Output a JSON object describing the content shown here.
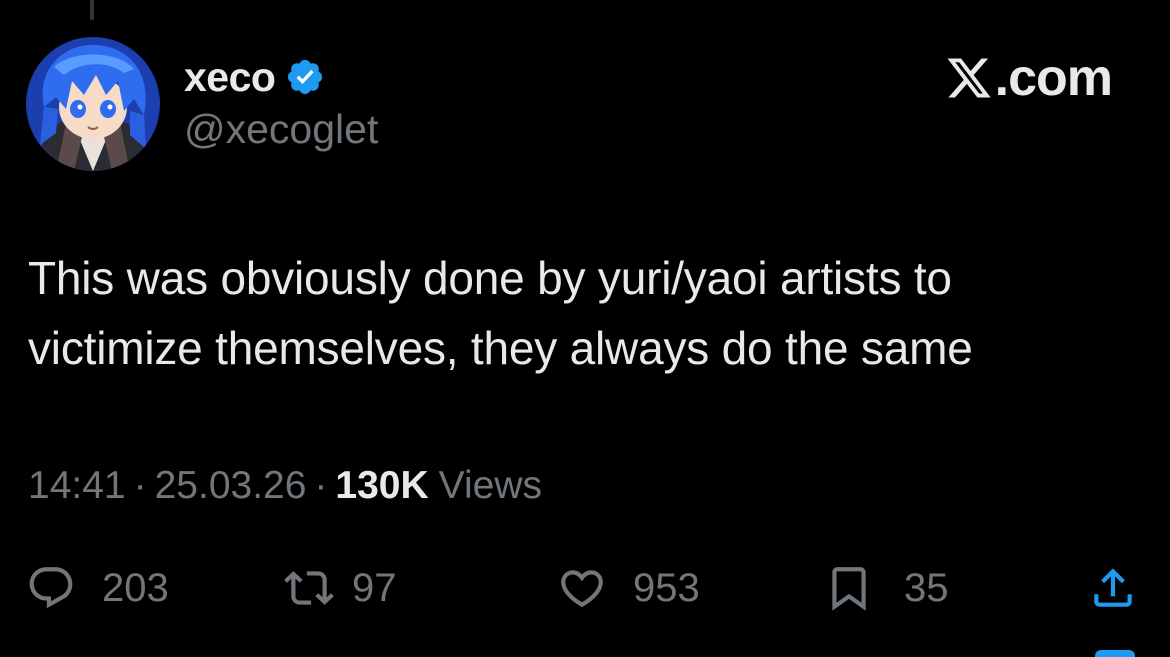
{
  "author": {
    "display_name": "xeco",
    "handle": "@xecoglet",
    "verified": true,
    "avatar_icon": "anime-avatar"
  },
  "brand": {
    "label": ".com",
    "icon": "x-logo-icon"
  },
  "tweet": {
    "text": "This was obviously done by yuri/yaoi artists to\nvictimize themselves, they always do the same"
  },
  "meta": {
    "time": "14:41",
    "separator": "·",
    "date": "25.03.26",
    "views_count": "130K",
    "views_label": "Views"
  },
  "actions": {
    "replies": "203",
    "reposts": "97",
    "likes": "953",
    "bookmarks": "35"
  },
  "colors": {
    "background": "#000000",
    "primary_text": "#e7e9ea",
    "secondary_text": "#71767b",
    "accent": "#1d9bf0"
  }
}
